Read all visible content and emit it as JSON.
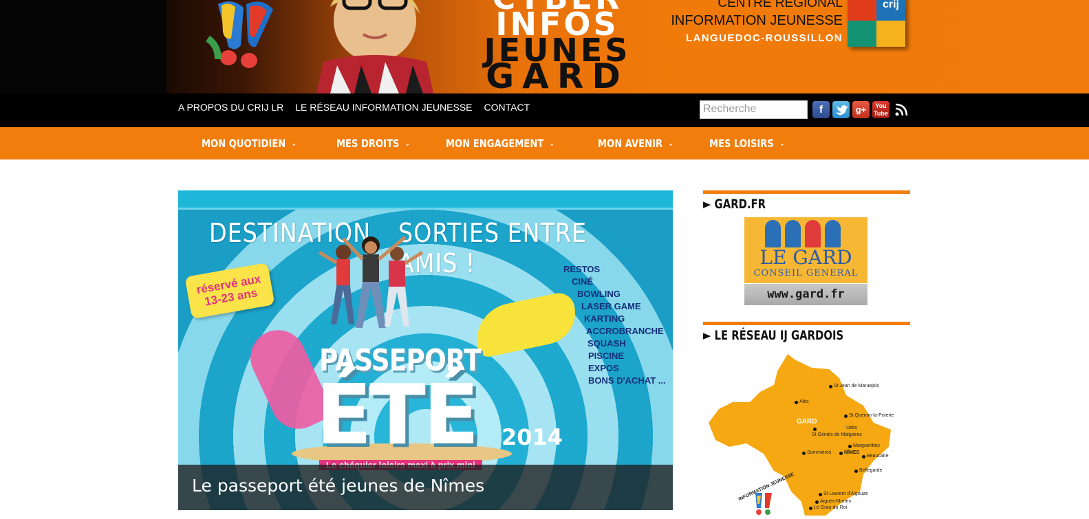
{
  "banner": {
    "brand_lines": [
      "CYBER",
      "INFOS",
      "JEUNES",
      "GARD"
    ],
    "crij_line1": "CENTRE RÉGIONAL",
    "crij_line2": "INFORMATION JEUNESSE",
    "crij_line3": "LANGUEDOC-ROUSSILLON",
    "crij_logo_label": "crij"
  },
  "topnav": {
    "links": [
      "A PROPOS DU CRIJ LR",
      "LE RÉSEAU INFORMATION JEUNESSE",
      "CONTACT"
    ],
    "search_placeholder": "Recherche",
    "social": {
      "facebook": "f",
      "twitter": "t",
      "googleplus": "g+",
      "youtube": "You Tube"
    }
  },
  "mainnav": {
    "items": [
      "MON QUOTIDIEN",
      "MES DROITS",
      "MON ENGAGEMENT",
      "MON AVENIR",
      "MES LOISIRS"
    ]
  },
  "slide": {
    "title_left": "DESTINATION",
    "title_right": "SORTIES ENTRE AMIS !",
    "tag": "réservé aux 13-23 ans",
    "activities": [
      "RESTOS",
      "CINÉ",
      "BOWLING",
      "LASER GAME",
      "KARTING",
      "ACCROBRANCHE",
      "SQUASH",
      "PISCINE",
      "EXPOS",
      "BONS D'ACHAT ..."
    ],
    "passeport": "PASSEPORT",
    "ete": "ÉTÉ",
    "year": "2014",
    "chequier": "Le chéquier loisirs maxi à prix mini",
    "caption": "Le passeport été jeunes de Nîmes"
  },
  "sidebar": {
    "widget1_title": "► GARD.FR",
    "gard_name": "LE GARD",
    "gard_sub": "CONSEIL GENERAL",
    "gard_url": "www.gard.fr",
    "widget2_title": "► LE RÉSEAU IJ GARDOIS",
    "map_region": "GARD",
    "map_towns": [
      "St Jean de Maruejols",
      "Alès",
      "St Quentin-la-Poterie",
      "Uzès",
      "St Géniès de Malgoires",
      "Marguerittes",
      "Sommières",
      "NÎMES",
      "Beaucaire",
      "Bellegarde",
      "St Laurent d'Aigouze",
      "Aigues-Mortes",
      "Le Grau-du-Roi"
    ],
    "map_badge": "INFORMATION JEUNESSE"
  },
  "colors": {
    "orange": "#f07d0c",
    "black": "#000000",
    "slide_blue": "#19b4d6",
    "gard_yellow": "#f6b735"
  },
  "icons": [
    "facebook-icon",
    "twitter-icon",
    "googleplus-icon",
    "youtube-icon",
    "rss-icon",
    "chevron-down-icon"
  ]
}
